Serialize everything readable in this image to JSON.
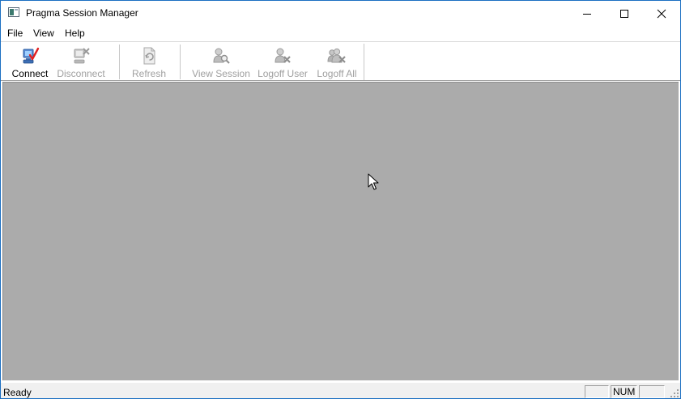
{
  "window": {
    "title": "Pragma Session Manager"
  },
  "menu": {
    "items": [
      "File",
      "View",
      "Help"
    ]
  },
  "toolbar": {
    "buttons": [
      {
        "label": "Connect",
        "icon": "connect-icon",
        "enabled": true
      },
      {
        "label": "Disconnect",
        "icon": "disconnect-icon",
        "enabled": false
      },
      {
        "label": "Refresh",
        "icon": "refresh-icon",
        "enabled": false
      },
      {
        "label": "View Session",
        "icon": "view-session-icon",
        "enabled": false
      },
      {
        "label": "Logoff User",
        "icon": "logoff-user-icon",
        "enabled": false
      },
      {
        "label": "Logoff All",
        "icon": "logoff-all-icon",
        "enabled": false
      }
    ]
  },
  "status": {
    "text": "Ready",
    "panes": [
      "",
      "NUM",
      ""
    ]
  },
  "colors": {
    "client_background": "#ababab",
    "window_border": "#1b6fc2",
    "disabled_text": "#a0a0a0",
    "connect_check": "#e02020"
  }
}
